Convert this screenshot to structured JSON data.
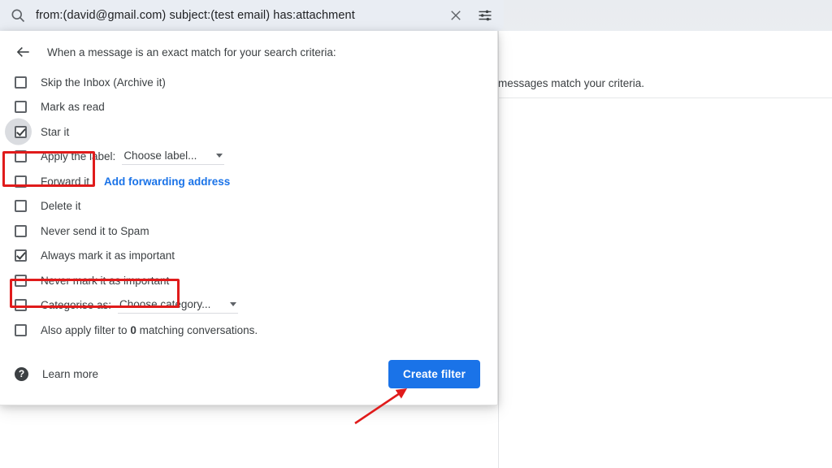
{
  "search": {
    "query": "from:(david@gmail.com) subject:(test email) has:attachment",
    "search_icon": "search-icon",
    "clear_icon": "close-icon",
    "options_icon": "tune-icon"
  },
  "background": {
    "message": "messages match your criteria."
  },
  "dialog": {
    "back_icon": "arrow-left-icon",
    "header": "When a message is an exact match for your search criteria:",
    "options": [
      {
        "label": "Skip the Inbox (Archive it)",
        "checked": false
      },
      {
        "label": "Mark as read",
        "checked": false
      },
      {
        "label": "Star it",
        "checked": true,
        "highlighted": true,
        "ripple": true
      },
      {
        "label": "Apply the label:",
        "checked": false,
        "dropdown": "Choose label..."
      },
      {
        "label": "Forward it",
        "checked": false,
        "link": "Add forwarding address"
      },
      {
        "label": "Delete it",
        "checked": false
      },
      {
        "label": "Never send it to Spam",
        "checked": false
      },
      {
        "label": "Always mark it as important",
        "checked": true,
        "highlighted": true
      },
      {
        "label": "Never mark it as important",
        "checked": false
      },
      {
        "label": "Categorise as:",
        "checked": false,
        "dropdown": "Choose category..."
      },
      {
        "label_pre": "Also apply filter to ",
        "label_bold": "0",
        "label_post": " matching conversations.",
        "checked": false
      }
    ],
    "footer": {
      "help_icon": "help-icon",
      "help_glyph": "?",
      "learn_more": "Learn more",
      "create_filter": "Create filter"
    }
  },
  "annotations": {
    "highlight_color": "#e01b1b",
    "arrow_color": "#e01b1b",
    "boxes": [
      "star-it-row",
      "always-mark-important-row"
    ],
    "arrow_target": "create-filter-button"
  },
  "colors": {
    "accent_blue": "#1a73e8",
    "text_primary": "#3c4043",
    "search_bar_bg": "#e9edf3",
    "annotation_red": "#e01b1b"
  }
}
